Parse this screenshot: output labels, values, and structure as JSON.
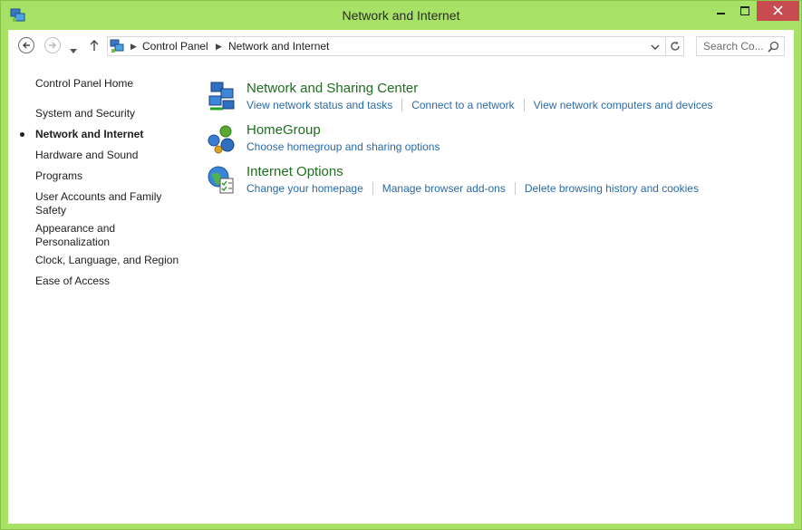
{
  "window": {
    "title": "Network and Internet",
    "frame_color": "#a7e165",
    "close_color": "#c74b50"
  },
  "addressbar": {
    "breadcrumbs": [
      "Control Panel",
      "Network and Internet"
    ]
  },
  "search": {
    "placeholder": "Search Co..."
  },
  "sidebar": {
    "items": [
      {
        "label": "Control Panel Home"
      },
      {
        "label": "System and Security"
      },
      {
        "label": "Network and Internet",
        "current": true
      },
      {
        "label": "Hardware and Sound"
      },
      {
        "label": "Programs"
      },
      {
        "label": "User Accounts and Family Safety"
      },
      {
        "label": "Appearance and Personalization"
      },
      {
        "label": "Clock, Language, and Region"
      },
      {
        "label": "Ease of Access"
      }
    ]
  },
  "categories": [
    {
      "title": "Network and Sharing Center",
      "icon": "network-sharing-icon",
      "links": [
        "View network status and tasks",
        "Connect to a network",
        "View network computers and devices"
      ]
    },
    {
      "title": "HomeGroup",
      "icon": "homegroup-icon",
      "links": [
        "Choose homegroup and sharing options"
      ]
    },
    {
      "title": "Internet Options",
      "icon": "internet-options-icon",
      "links": [
        "Change your homepage",
        "Manage browser add-ons",
        "Delete browsing history and cookies"
      ]
    }
  ],
  "colors": {
    "category_title": "#1e6e1e",
    "link": "#2a6aa8"
  }
}
